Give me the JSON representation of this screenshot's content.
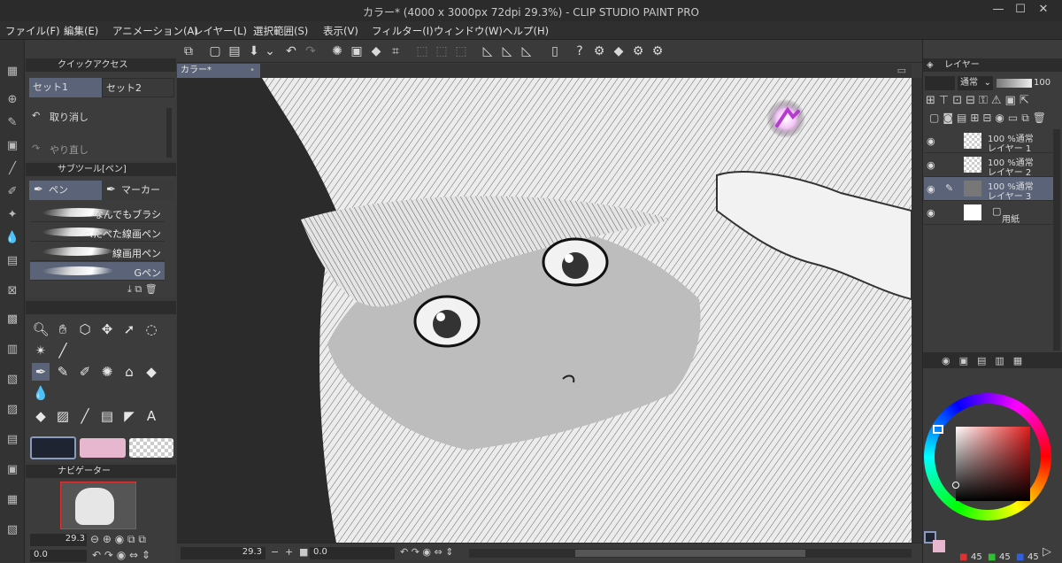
{
  "window": {
    "title": "カラー* (4000 x 3000px 72dpi 29.3%)  - CLIP STUDIO PAINT PRO",
    "controls": [
      "minimize-icon",
      "maximize-icon",
      "close-icon"
    ]
  },
  "menu": [
    "ファイル(F)",
    "編集(E)",
    "アニメーション(A)",
    "レイヤー(L)",
    "選択範囲(S)",
    "表示(V)",
    "フィルター(I)",
    "ウィンドウ(W)",
    "ヘルプ(H)"
  ],
  "quick_access": {
    "title": "クイックアクセス",
    "tabs": [
      "セット1",
      "セット2"
    ],
    "items": [
      "取り消し",
      "やり直し"
    ]
  },
  "sub_tool": {
    "title": "サブツール[ペン]",
    "tabs": [
      "ペン",
      "マーカー"
    ],
    "brushes": [
      "なんでもブラシ",
      "べたべた線画ペン",
      "線画用ペン",
      "Gペン"
    ],
    "selected": "Gペン"
  },
  "navigator": {
    "title": "ナビゲーター",
    "zoom": "29.3",
    "rotation": "0.0"
  },
  "canvas": {
    "tab": "カラー*",
    "zoom": "29.3",
    "rotation": "0.0"
  },
  "layers": {
    "title": "レイヤー",
    "blend_mode": "通常",
    "opacity": "100",
    "items": [
      {
        "opacity_mode": "100 %通常",
        "name": "レイヤー 1"
      },
      {
        "opacity_mode": "100 %通常",
        "name": "レイヤー 2"
      },
      {
        "opacity_mode": "100 %通常",
        "name": "レイヤー 3"
      },
      {
        "opacity_mode": "",
        "name": "用紙"
      }
    ],
    "selected_index": 2
  },
  "color": {
    "main_color": "#1f2433",
    "sub_color": "#e7b6cf",
    "rgb": [
      "45",
      "45",
      "45"
    ],
    "accent": "#5a6378"
  }
}
